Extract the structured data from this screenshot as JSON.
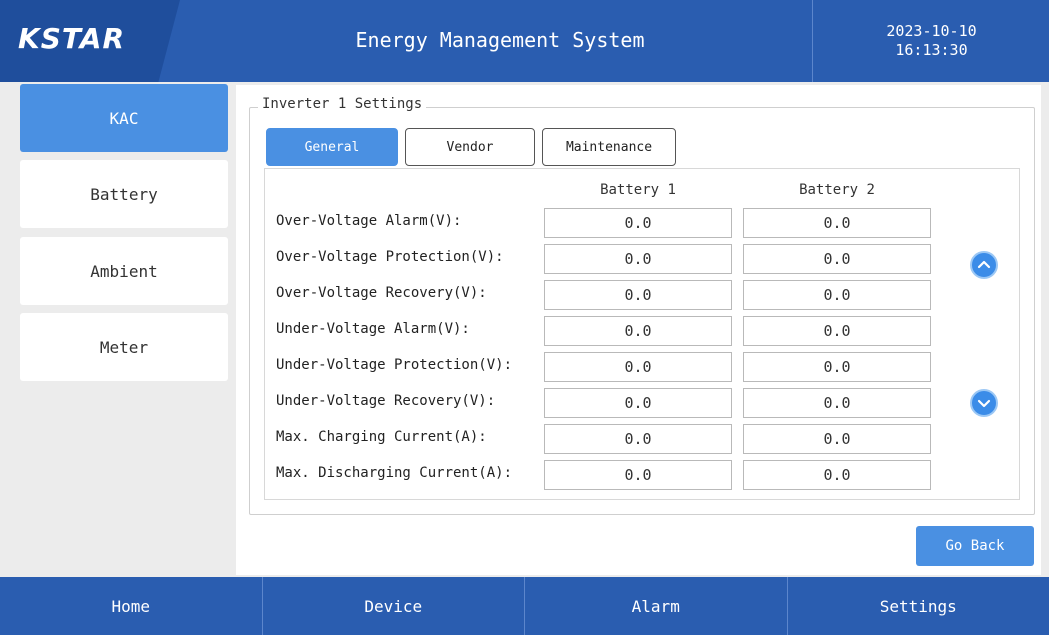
{
  "header": {
    "logo": "KSTAR",
    "title": "Energy Management System",
    "date": "2023-10-10",
    "time": "16:13:30"
  },
  "sidebar": {
    "items": [
      {
        "label": "KAC",
        "active": true
      },
      {
        "label": "Battery",
        "active": false
      },
      {
        "label": "Ambient",
        "active": false
      },
      {
        "label": "Meter",
        "active": false
      }
    ]
  },
  "panel": {
    "group_title": "Inverter 1 Settings",
    "tabs": [
      {
        "label": "General",
        "active": true
      },
      {
        "label": "Vendor",
        "active": false
      },
      {
        "label": "Maintenance",
        "active": false
      }
    ],
    "columns": [
      "Battery 1",
      "Battery 2"
    ],
    "rows": [
      {
        "label": "Over-Voltage Alarm(V):",
        "battery1": "0.0",
        "battery2": "0.0"
      },
      {
        "label": "Over-Voltage Protection(V):",
        "battery1": "0.0",
        "battery2": "0.0"
      },
      {
        "label": "Over-Voltage Recovery(V):",
        "battery1": "0.0",
        "battery2": "0.0"
      },
      {
        "label": "Under-Voltage Alarm(V):",
        "battery1": "0.0",
        "battery2": "0.0"
      },
      {
        "label": "Under-Voltage Protection(V):",
        "battery1": "0.0",
        "battery2": "0.0"
      },
      {
        "label": "Under-Voltage Recovery(V):",
        "battery1": "0.0",
        "battery2": "0.0"
      },
      {
        "label": "Max. Charging Current(A):",
        "battery1": "0.0",
        "battery2": "0.0"
      },
      {
        "label": "Max. Discharging Current(A):",
        "battery1": "0.0",
        "battery2": "0.0"
      }
    ],
    "scroll_up_icon": "chevron-up-icon",
    "scroll_down_icon": "chevron-down-icon",
    "go_back_label": "Go Back"
  },
  "bottom_nav": {
    "items": [
      "Home",
      "Device",
      "Alarm",
      "Settings"
    ]
  },
  "colors": {
    "header_blue": "#2a5db0",
    "accent_blue": "#4a90e2"
  }
}
